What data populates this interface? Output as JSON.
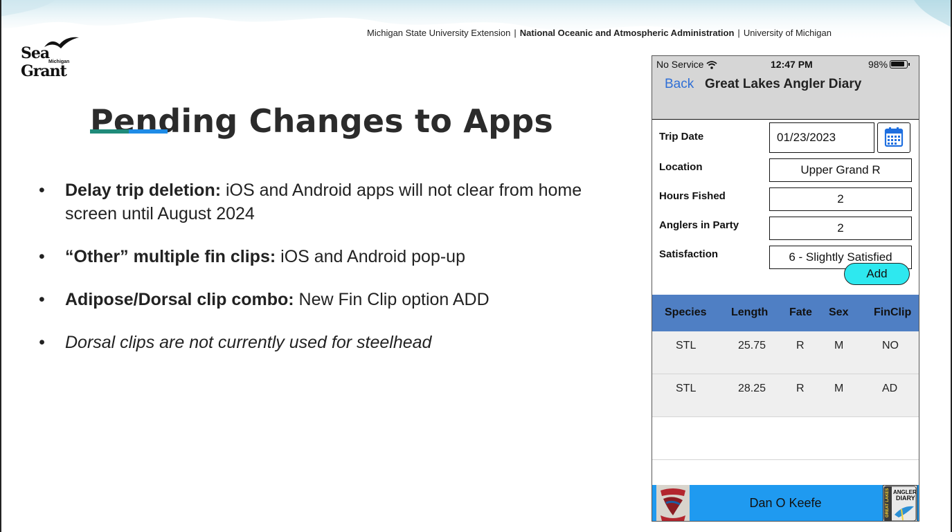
{
  "logo": {
    "name": "Sea Grant",
    "sub": "Michigan"
  },
  "affiliations": {
    "org1": "Michigan State University Extension",
    "sep1": "|",
    "org2": "National Oceanic and Atmospheric Administration",
    "sep2": "|",
    "org3": "University of Michigan"
  },
  "title": "Pending Changes to Apps",
  "bullets": [
    {
      "bold": "Delay trip deletion:",
      "text": " iOS and Android apps will not clear from home screen until August 2024"
    },
    {
      "bold": "“Other” multiple fin clips:",
      "text": " iOS and Android pop-up"
    },
    {
      "bold": "Adipose/Dorsal clip combo:",
      "text": " New Fin Clip option ADD"
    },
    {
      "bold": "",
      "text": "Dorsal clips are not currently used for steelhead"
    }
  ],
  "bullet_glyph": "•",
  "phone": {
    "status": {
      "service": "No Service",
      "time": "12:47 PM",
      "battery": "98%"
    },
    "nav": {
      "back": "Back",
      "title": "Great Lakes Angler Diary"
    },
    "form": {
      "trip_date_label": "Trip Date",
      "trip_date_value": "01/23/2023",
      "location_label": "Location",
      "location_value": "Upper Grand R",
      "hours_label": "Hours Fished",
      "hours_value": "2",
      "anglers_label": "Anglers in Party",
      "anglers_value": "2",
      "satisfaction_label": "Satisfaction",
      "satisfaction_value": "6 - Slightly Satisfied",
      "add_label": "Add"
    },
    "table": {
      "headers": [
        "Species",
        "Length",
        "Fate",
        "Sex",
        "FinClip"
      ],
      "rows": [
        [
          "STL",
          "25.75",
          "R",
          "M",
          "NO"
        ],
        [
          "STL",
          "28.25",
          "R",
          "M",
          "AD"
        ]
      ]
    },
    "footer": {
      "name": "Dan O Keefe",
      "app_logo_line1": "ANGLER",
      "app_logo_line2": "DIARY",
      "app_logo_side": "GREAT LAKES"
    }
  },
  "colors": {
    "accent_teal": "#1f8b7a",
    "accent_blue": "#1e8be6",
    "ios_link": "#2f6fd6",
    "table_header": "#4f7fc4",
    "add_button": "#2ee8ef",
    "footer_bar": "#1f9af0"
  }
}
